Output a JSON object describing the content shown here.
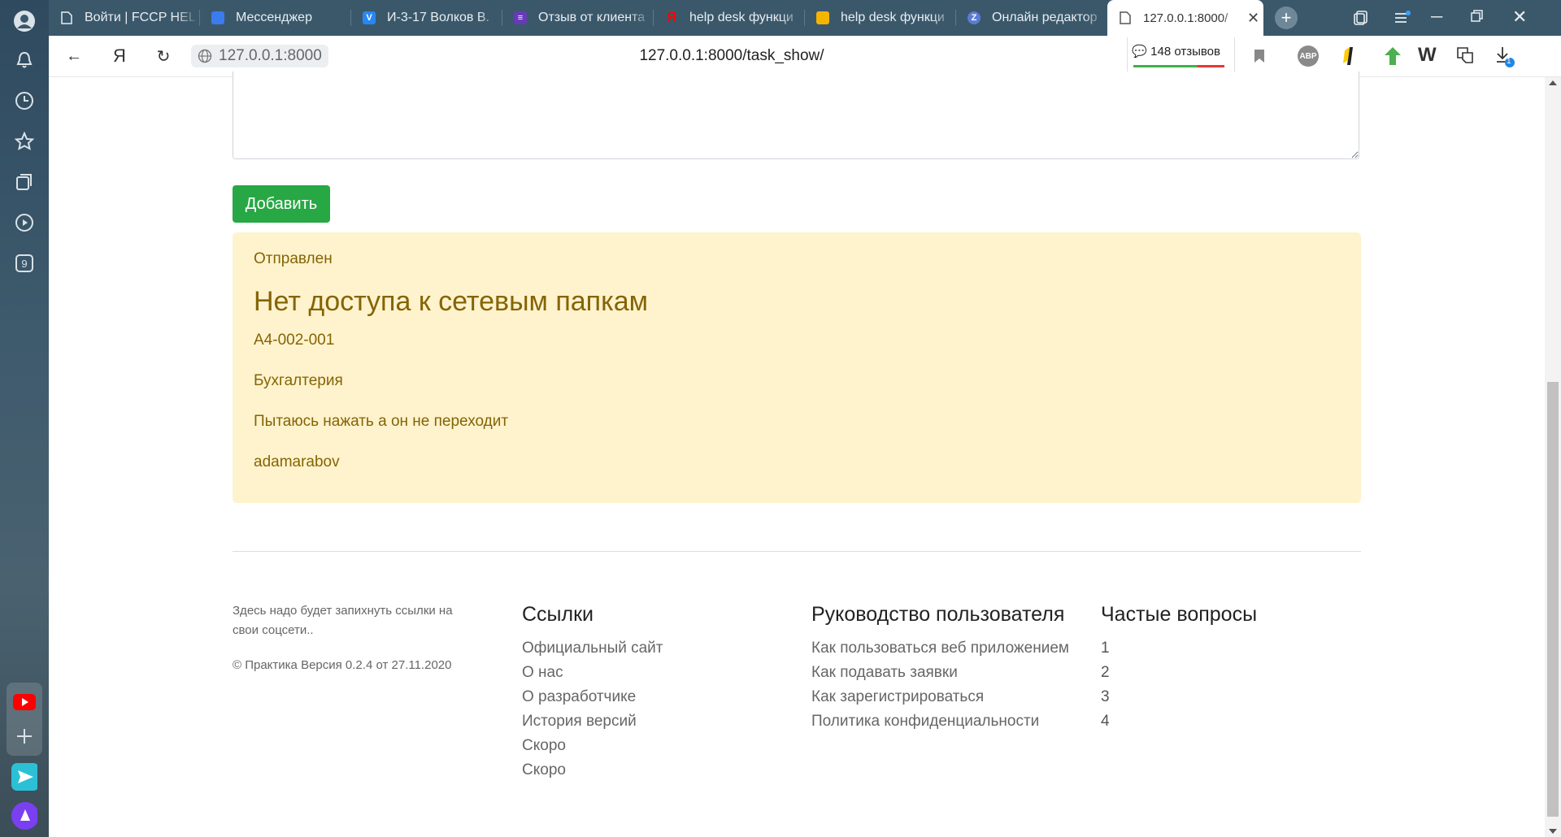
{
  "browser": {
    "tabs": [
      {
        "title": "Войти | FCCP HEL",
        "fav_color": "#3b586b",
        "fav_icon": "document-icon"
      },
      {
        "title": "Мессенджер",
        "fav_color": "#3a7bf0",
        "fav_icon": "messenger-icon"
      },
      {
        "title": "И-3-17 Волков В.",
        "fav_color": "#2787f5",
        "fav_icon": "vk-icon"
      },
      {
        "title": "Отзыв от клиента",
        "fav_color": "#673ab7",
        "fav_icon": "form-icon"
      },
      {
        "title": "help desk функци",
        "fav_color": "#ff0000",
        "fav_icon": "yandex-icon"
      },
      {
        "title": "help desk функци",
        "fav_color": "#f5b400",
        "fav_icon": "images-icon"
      },
      {
        "title": "Онлайн редактор",
        "fav_color": "#5b7bd5",
        "fav_icon": "editor-icon"
      },
      {
        "title": "127.0.0.1:8000/",
        "fav_color": "#888888",
        "fav_icon": "document-icon",
        "active": true
      }
    ],
    "origin": "127.0.0.1:8000",
    "url": "127.0.0.1:8000/task_show/",
    "reviews": "148 отзывов",
    "download_badge": "1",
    "sidebar_badge": "9"
  },
  "page": {
    "add_button": "Добавить",
    "task": {
      "status": "Отправлен",
      "title": "Нет доступа к сетевым папкам",
      "code": "А4-002-001",
      "department": "Бухгалтерия",
      "description": "Пытаюсь нажать а он не переходит",
      "user": "adamarabov"
    },
    "footer": {
      "note": "Здесь надо будет запихнуть ссылки на свои соцсети..",
      "copyright": "© Практика Версия 0.2.4 от 27.11.2020",
      "links_title": "Ссылки",
      "links": [
        "Официальный сайт",
        "О нас",
        "О разработчике",
        "История версий",
        "Скоро",
        "Скоро"
      ],
      "guide_title": "Руководство пользователя",
      "guide": [
        "Как пользоваться веб приложением",
        "Как подавать заявки",
        "Как зарегистрироваться",
        "Политика конфиденциальности"
      ],
      "faq_title": "Частые вопросы",
      "faq": [
        "1",
        "2",
        "3",
        "4"
      ]
    }
  }
}
